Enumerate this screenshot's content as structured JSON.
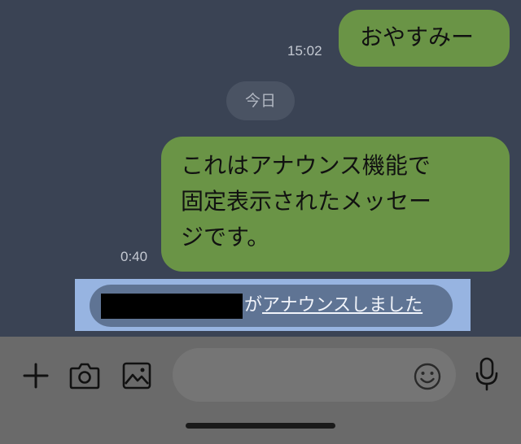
{
  "messages": [
    {
      "text": "おやすみー",
      "time": "15:02"
    },
    {
      "lines": [
        "これはアナウンス機能で",
        "固定表示されたメッセー",
        "ジです。"
      ],
      "time": "0:40"
    }
  ],
  "date_separator": "今日",
  "announcement": {
    "prefix": "が",
    "link_text": "アナウンスしました"
  },
  "input": {
    "placeholder": ""
  },
  "icons": {
    "plus": "plus-icon",
    "camera": "camera-icon",
    "image": "image-icon",
    "emoji": "emoji-icon",
    "mic": "microphone-icon"
  },
  "colors": {
    "chat_background": "#3a4354",
    "outgoing_bubble": "#6a9446",
    "announcement_bar": "#97b4e1",
    "announcement_pill": "#5f7494",
    "input_bar": "#6a6a6a"
  }
}
